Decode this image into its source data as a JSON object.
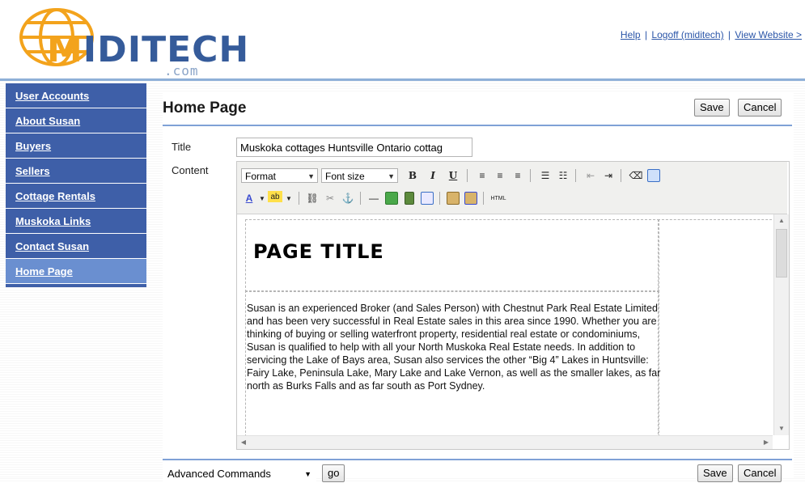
{
  "header": {
    "logo_text_m": "M",
    "logo_text_rest": "IDITECH",
    "logo_com": ".com",
    "links": [
      "Help",
      "Logoff (miditech)",
      "View Website >"
    ],
    "link_separator": "|"
  },
  "sidebar": {
    "items": [
      {
        "label": "User Accounts"
      },
      {
        "label": "About Susan"
      },
      {
        "label": "Buyers"
      },
      {
        "label": "Sellers"
      },
      {
        "label": "Cottage Rentals"
      },
      {
        "label": "Muskoka Links"
      },
      {
        "label": "Contact Susan"
      },
      {
        "label": "Home Page"
      }
    ],
    "active": "Home Page"
  },
  "main": {
    "page_title": "Home Page",
    "save_label": "Save",
    "cancel_label": "Cancel",
    "title_label": "Title",
    "title_value": "Muskoka cottages Huntsville Ontario cottag",
    "content_label": "Content"
  },
  "editor": {
    "format_select": "Format",
    "fontsize_select": "Font size",
    "bold": "B",
    "italic": "I",
    "underline": "U",
    "html_button": "HTML",
    "page_heading": "PAGE TITLE",
    "body_text": "Susan is an experienced Broker (and Sales Person) with Chestnut Park Real Estate Limited and has been very successful in Real Estate sales in this area since 1990. Whether you are thinking of buying or selling waterfront property, residential real estate or condominiums, Susan is qualified to help with all your North Muskoka Real Estate needs. In addition to servicing the Lake of Bays area, Susan also services the other “Big 4” Lakes in Huntsville: Fairy Lake, Peninsula Lake, Mary Lake and Lake Vernon, as well as the smaller lakes, as far north as Burks Falls and as far south as Port Sydney."
  },
  "bottom": {
    "advanced_select": "Advanced Commands",
    "go_label": "go",
    "save_label": "Save",
    "cancel_label": "Cancel"
  },
  "colors": {
    "nav_bg": "#3e5fa8",
    "nav_active_bg": "#6a8fd0",
    "link": "#2a55a8",
    "logo_orange": "#f3a31c",
    "logo_blue": "#355b9a",
    "rule_blue": "#7fa1d6"
  }
}
